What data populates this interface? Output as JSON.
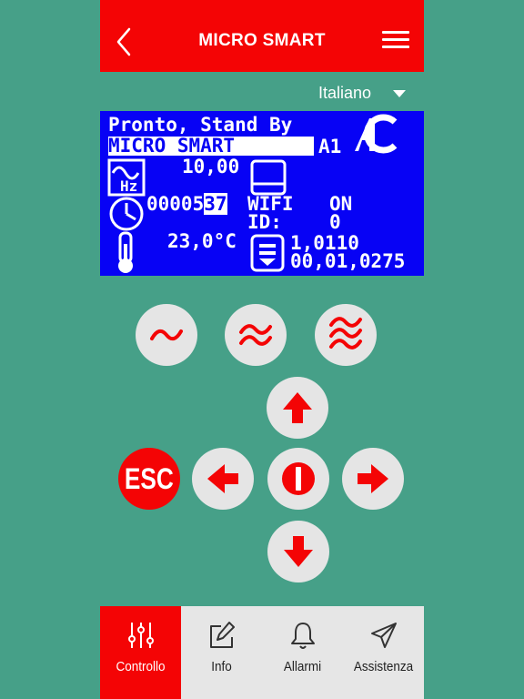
{
  "header": {
    "title": "MICRO SMART"
  },
  "language": {
    "selected": "Italiano"
  },
  "display": {
    "status": "Pronto, Stand By",
    "model": "MICRO SMART",
    "unit": "A1",
    "frequency": "10,00",
    "hz_label": "Hz",
    "hours_prefix": "00005",
    "hours_highlight": "37",
    "wifi_label": "WIFI",
    "wifi_value": "ON",
    "id_label": "ID:",
    "id_value": "0",
    "temperature": "23,0°C",
    "version": "1,0110",
    "firmware": "00,01,0275"
  },
  "controls": {
    "esc_label": "ESC"
  },
  "tabs": [
    {
      "label": "Controllo",
      "icon": "sliders-icon",
      "active": true
    },
    {
      "label": "Info",
      "icon": "edit-icon",
      "active": false
    },
    {
      "label": "Allarmi",
      "icon": "bell-icon",
      "active": false
    },
    {
      "label": "Assistenza",
      "icon": "send-icon",
      "active": false
    }
  ],
  "colors": {
    "accent": "#f40405",
    "background": "#46a088",
    "lcd": "#0702f5",
    "button": "#e5e5e5"
  }
}
